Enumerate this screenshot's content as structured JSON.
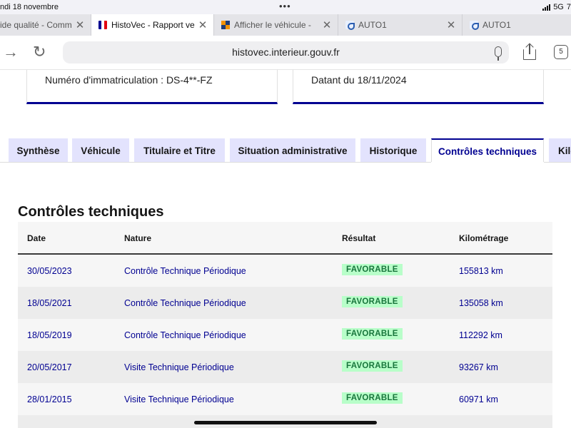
{
  "status_bar": {
    "date": "ndi 18 novembre",
    "network": "5G",
    "battery_text": "7"
  },
  "browser_tabs": [
    {
      "title": "ide qualité - Comm",
      "favicon": "generic-page-icon",
      "active": false
    },
    {
      "title": "HistoVec - Rapport ve",
      "favicon": "french-flag-icon",
      "active": true
    },
    {
      "title": "Afficher le véhicule - ",
      "favicon": "grid-logo-icon",
      "active": false
    },
    {
      "title": "AUTO1",
      "favicon": "auto1-icon",
      "active": false
    },
    {
      "title": "AUTO1",
      "favicon": "auto1-icon",
      "active": false
    }
  ],
  "address_bar": {
    "url": "histovec.interieur.gouv.fr",
    "tab_count": "5"
  },
  "cards": {
    "immatriculation": "Numéro d'immatriculation : DS-4**-FZ",
    "datant": "Datant du 18/11/2024"
  },
  "page_tabs": [
    {
      "label": "Synthèse",
      "active": false
    },
    {
      "label": "Véhicule",
      "active": false
    },
    {
      "label": "Titulaire et Titre",
      "active": false
    },
    {
      "label": "Situation administrative",
      "active": false
    },
    {
      "label": "Historique",
      "active": false
    },
    {
      "label": "Contrôles techniques",
      "active": true
    },
    {
      "label": "Kilo",
      "active": false
    }
  ],
  "section_title": "Contrôles techniques",
  "table": {
    "headers": {
      "date": "Date",
      "nature": "Nature",
      "resultat": "Résultat",
      "kilometrage": "Kilométrage"
    },
    "rows": [
      {
        "date": "30/05/2023",
        "nature": "Contrôle Technique Périodique",
        "resultat": "FAVORABLE",
        "kilometrage": "155813 km"
      },
      {
        "date": "18/05/2021",
        "nature": "Contrôle Technique Périodique",
        "resultat": "FAVORABLE",
        "kilometrage": "135058 km"
      },
      {
        "date": "18/05/2019",
        "nature": "Contrôle Technique Périodique",
        "resultat": "FAVORABLE",
        "kilometrage": "112292 km"
      },
      {
        "date": "20/05/2017",
        "nature": "Visite Technique Périodique",
        "resultat": "FAVORABLE",
        "kilometrage": "93267 km"
      },
      {
        "date": "28/01/2015",
        "nature": "Visite Technique Périodique",
        "resultat": "FAVORABLE",
        "kilometrage": "60971 km"
      }
    ]
  },
  "colors": {
    "dsfr_blue": "#000091",
    "tab_inactive_bg": "#e3e3fd",
    "badge_bg": "#b8fec9",
    "badge_text": "#18753c"
  }
}
